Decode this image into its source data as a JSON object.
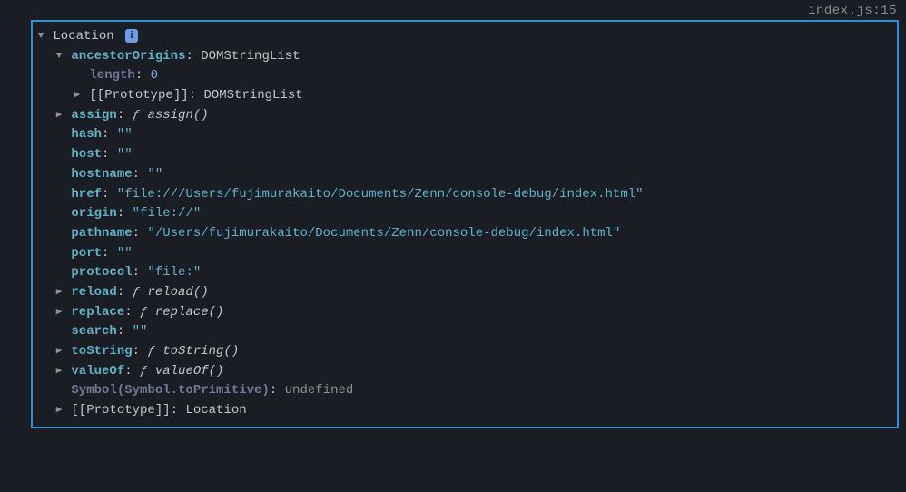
{
  "source": "index.js:15",
  "root": {
    "label": "Location"
  },
  "props": {
    "ancestorOrigins": {
      "key": "ancestorOrigins",
      "value": "DOMStringList"
    },
    "ancestorOrigins_length": {
      "key": "length",
      "value": "0"
    },
    "ancestorOrigins_proto": {
      "key": "[[Prototype]]",
      "value": "DOMStringList"
    },
    "assign": {
      "key": "assign",
      "fn": "assign()"
    },
    "hash": {
      "key": "hash",
      "value": "\"\""
    },
    "host": {
      "key": "host",
      "value": "\"\""
    },
    "hostname": {
      "key": "hostname",
      "value": "\"\""
    },
    "href": {
      "key": "href",
      "value": "\"file:///Users/fujimurakaito/Documents/Zenn/console-debug/index.html\""
    },
    "origin": {
      "key": "origin",
      "value": "\"file://\""
    },
    "pathname": {
      "key": "pathname",
      "value": "\"/Users/fujimurakaito/Documents/Zenn/console-debug/index.html\""
    },
    "port": {
      "key": "port",
      "value": "\"\""
    },
    "protocol": {
      "key": "protocol",
      "value": "\"file:\""
    },
    "reload": {
      "key": "reload",
      "fn": "reload()"
    },
    "replace": {
      "key": "replace",
      "fn": "replace()"
    },
    "search": {
      "key": "search",
      "value": "\"\""
    },
    "toString": {
      "key": "toString",
      "fn": "toString()"
    },
    "valueOf": {
      "key": "valueOf",
      "fn": "valueOf()"
    },
    "symbolToPrimitive": {
      "key": "Symbol(Symbol.toPrimitive)",
      "value": "undefined"
    },
    "proto": {
      "key": "[[Prototype]]",
      "value": "Location"
    }
  },
  "glyphs": {
    "f": "ƒ",
    "info": "i"
  }
}
